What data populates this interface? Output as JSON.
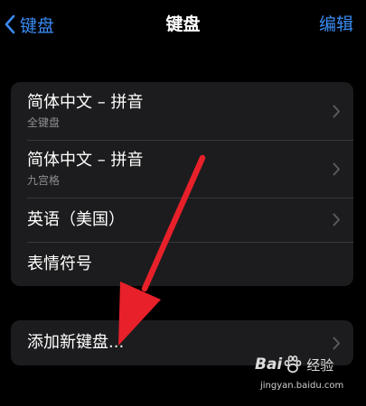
{
  "nav": {
    "back_label": "键盘",
    "title": "键盘",
    "edit_label": "编辑"
  },
  "keyboards": [
    {
      "title": "简体中文 – 拼音",
      "subtitle": "全键盘"
    },
    {
      "title": "简体中文 – 拼音",
      "subtitle": "九宫格"
    },
    {
      "title": "英语（美国）"
    },
    {
      "title": "表情符号"
    }
  ],
  "add_keyboard": {
    "label": "添加新键盘..."
  },
  "watermark": {
    "brand_left": "Bai",
    "brand_right": "经验",
    "url": "jingyan.baidu.com"
  },
  "colors": {
    "accent": "#3a8cf4",
    "background": "#000000",
    "cell": "#1c1c1e",
    "separator": "#38383a",
    "secondary_text": "#8e8e93",
    "chevron": "#5a5a5e",
    "annotation_arrow": "#e8202a"
  },
  "icons": {
    "back": "chevron-left-icon",
    "row_disclosure": "chevron-right-icon",
    "watermark": "baidu-paw-icon"
  }
}
